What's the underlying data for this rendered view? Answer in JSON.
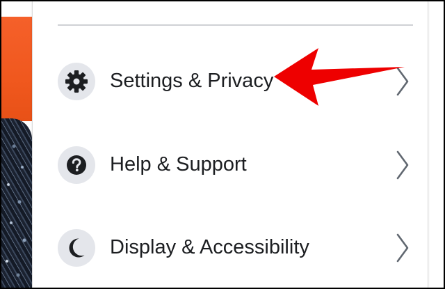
{
  "menu": {
    "items": [
      {
        "label": "Settings & Privacy",
        "icon": "gear-icon"
      },
      {
        "label": "Help & Support",
        "icon": "question-circle-icon"
      },
      {
        "label": "Display & Accessibility",
        "icon": "moon-icon"
      }
    ]
  },
  "annotation": {
    "arrow_color": "#ee0000",
    "arrow_icon": "red-arrow-pointer"
  },
  "colors": {
    "icon_background": "#e4e6eb",
    "text": "#1c1e21",
    "chevron": "#606770",
    "cover_orange": "#f0581e"
  }
}
